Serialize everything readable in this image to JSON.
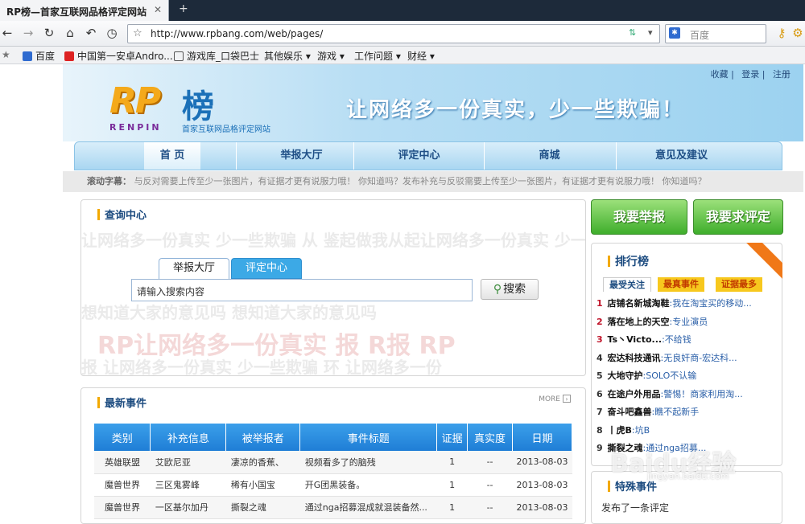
{
  "browser": {
    "tab_title": "RP榜—首家互联网品格评定网站",
    "url": "http://www.rpbang.com/web/pages/",
    "search_engine": "百度",
    "bookmarks": [
      "百度",
      "中国第一安卓Andro...",
      "游戏库_口袋巴士",
      "其他娱乐",
      "游戏",
      "工作问题",
      "财经"
    ]
  },
  "header": {
    "links": [
      "收藏",
      "登录",
      "注册"
    ],
    "logo_main": "RP",
    "logo_bang": "榜",
    "logo_renpin": "RENPIN",
    "logo_sub": "首家互联网品格评定网站",
    "slogan": "让网络多一份真实，少一些欺骗！"
  },
  "nav": [
    "首 页",
    "举报大厅",
    "评定中心",
    "商城",
    "意见及建议"
  ],
  "ticker": {
    "label": "滚动字幕：",
    "text": "与反对需要上传至少一张图片，有证据才更有说服力哦！   你知道吗？发布补充与反驳需要上传至少一张图片，有证据才更有说服力哦！   你知道吗？"
  },
  "query": {
    "title": "查询中心",
    "tabs": [
      "举报大厅",
      "评定中心"
    ],
    "placeholder": "请输入搜索内容",
    "button": "搜索"
  },
  "latest": {
    "title": "最新事件",
    "more": "MORE",
    "columns": [
      "类别",
      "补充信息",
      "被举报者",
      "事件标题",
      "证据",
      "真实度",
      "日期"
    ],
    "rows": [
      [
        "英雄联盟",
        "艾欧尼亚",
        "凄凉的香蕉、",
        "视频看多了的脑残",
        "1",
        "--",
        "2013-08-03"
      ],
      [
        "魔兽世界",
        "三区鬼雾峰",
        "稀有小国宝",
        "开G团黑装备。",
        "1",
        "--",
        "2013-08-03"
      ],
      [
        "魔兽世界",
        "一区基尔加丹",
        "撕裂之魂",
        "通过nga招募混成就混装备然...",
        "1",
        "--",
        "2013-08-03"
      ]
    ]
  },
  "actions": {
    "report": "我要举报",
    "rate": "我要求评定"
  },
  "ranking": {
    "title": "排行榜",
    "tabs": [
      "最受关注",
      "最真事件",
      "证据最多"
    ],
    "items": [
      {
        "n": "1",
        "t": "店铺名新城淘鞋",
        "d": ":我在淘宝买的移动..."
      },
      {
        "n": "2",
        "t": "落在地上的天空",
        "d": ":专业演员"
      },
      {
        "n": "3",
        "t": "Ts丶Victo...",
        "d": ":不给钱"
      },
      {
        "n": "4",
        "t": "宏达科技通讯",
        "d": ":无良奸商-宏达科..."
      },
      {
        "n": "5",
        "t": "大地守护",
        "d": ":SOLO不认输"
      },
      {
        "n": "6",
        "t": "在途户外用品",
        "d": ":警惕！商家利用淘..."
      },
      {
        "n": "7",
        "t": "奋斗吧鑫兽",
        "d": ":瞧不起新手"
      },
      {
        "n": "8",
        "t": "丨虎B",
        "d": ":坑B"
      },
      {
        "n": "9",
        "t": "撕裂之魂",
        "d": ":通过nga招募..."
      }
    ]
  },
  "special": {
    "title": "特殊事件",
    "text": "发布了一条评定"
  },
  "watermark": {
    "brand": "Baidu经验",
    "url": "jingyan.baidu.com"
  }
}
